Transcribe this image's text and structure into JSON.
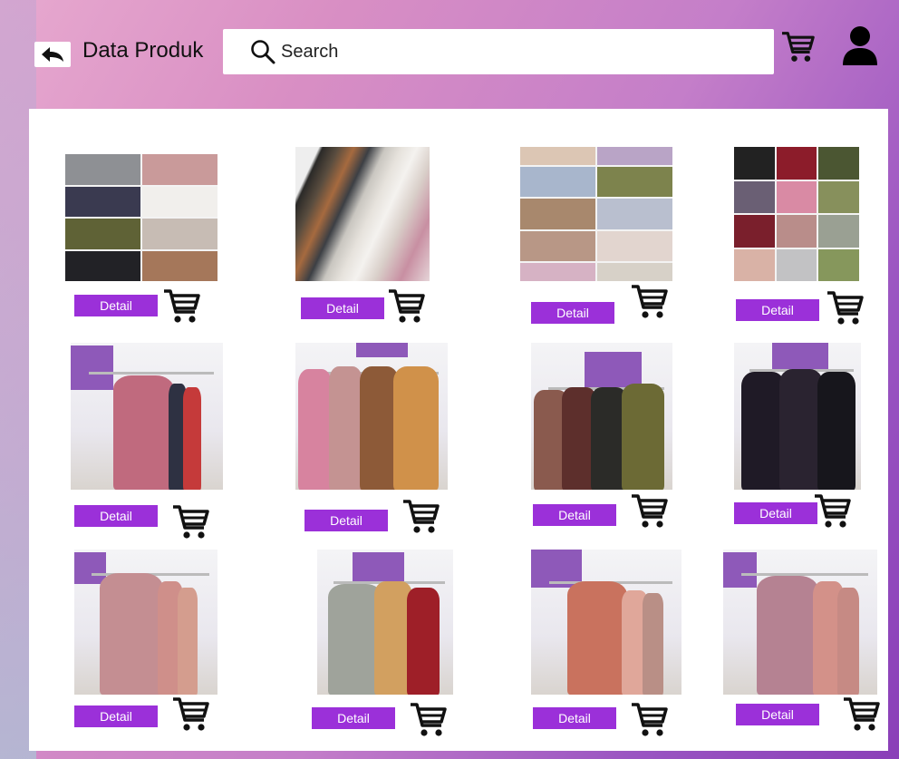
{
  "header": {
    "title": "Data Produk",
    "search_placeholder": "Search"
  },
  "products": [
    {
      "detail_label": "Detail",
      "image": "hijab-swatches-8"
    },
    {
      "detail_label": "Detail",
      "image": "hijab-folded-rolls"
    },
    {
      "detail_label": "Detail",
      "image": "hijab-swatches-pastel"
    },
    {
      "detail_label": "Detail",
      "image": "hijab-swatches-12"
    },
    {
      "detail_label": "Detail",
      "image": "dress-pink-tiered"
    },
    {
      "detail_label": "Detail",
      "image": "dress-ruffle-4"
    },
    {
      "detail_label": "Detail",
      "image": "dress-layered-4"
    },
    {
      "detail_label": "Detail",
      "image": "dress-black-print"
    },
    {
      "detail_label": "Detail",
      "image": "dress-mauve-shirt"
    },
    {
      "detail_label": "Detail",
      "image": "dress-grey-mustard-red"
    },
    {
      "detail_label": "Detail",
      "image": "dress-salmon-belted"
    },
    {
      "detail_label": "Detail",
      "image": "dress-mauve-button"
    }
  ],
  "colors": {
    "detail_button": "#9b30d9",
    "icon": "#000000",
    "panel": "#ffffff"
  },
  "icons": {
    "back": "arrow-back-icon",
    "search": "search-icon",
    "cart": "shopping-cart-icon",
    "user": "user-icon"
  }
}
